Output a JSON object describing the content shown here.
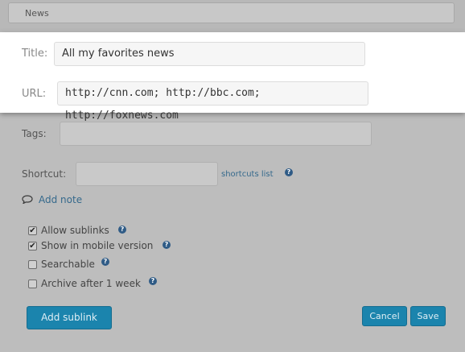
{
  "header": {
    "tab_label": "News"
  },
  "form": {
    "title_label": "Title:",
    "title_value": "All my favorites news",
    "url_label": "URL:",
    "url_value": "http://cnn.com; http://bbc.com; http://foxnews.com",
    "tags_label": "Tags:",
    "tags_value": "",
    "shortcut_label": "Shortcut:",
    "shortcut_value": "",
    "shortcuts_link": "shortcuts list",
    "add_note_label": "Add note",
    "help_glyph": "?"
  },
  "options": [
    {
      "label": "Allow sublinks",
      "checked": true
    },
    {
      "label": "Show in mobile version",
      "checked": true
    },
    {
      "label": "Searchable",
      "checked": false
    },
    {
      "label": "Archive after 1 week",
      "checked": false
    }
  ],
  "buttons": {
    "add_sublink": "Add sublink",
    "cancel": "Cancel",
    "save": "Save"
  },
  "colors": {
    "overlay": "#bdbdbd",
    "highlight": "#ffffff",
    "button": "#1b84ad",
    "help_icon": "#2f5b86"
  },
  "icons": {
    "note": "speech-bubble-icon",
    "help": "help-circle-icon",
    "check": "checkmark-icon"
  }
}
